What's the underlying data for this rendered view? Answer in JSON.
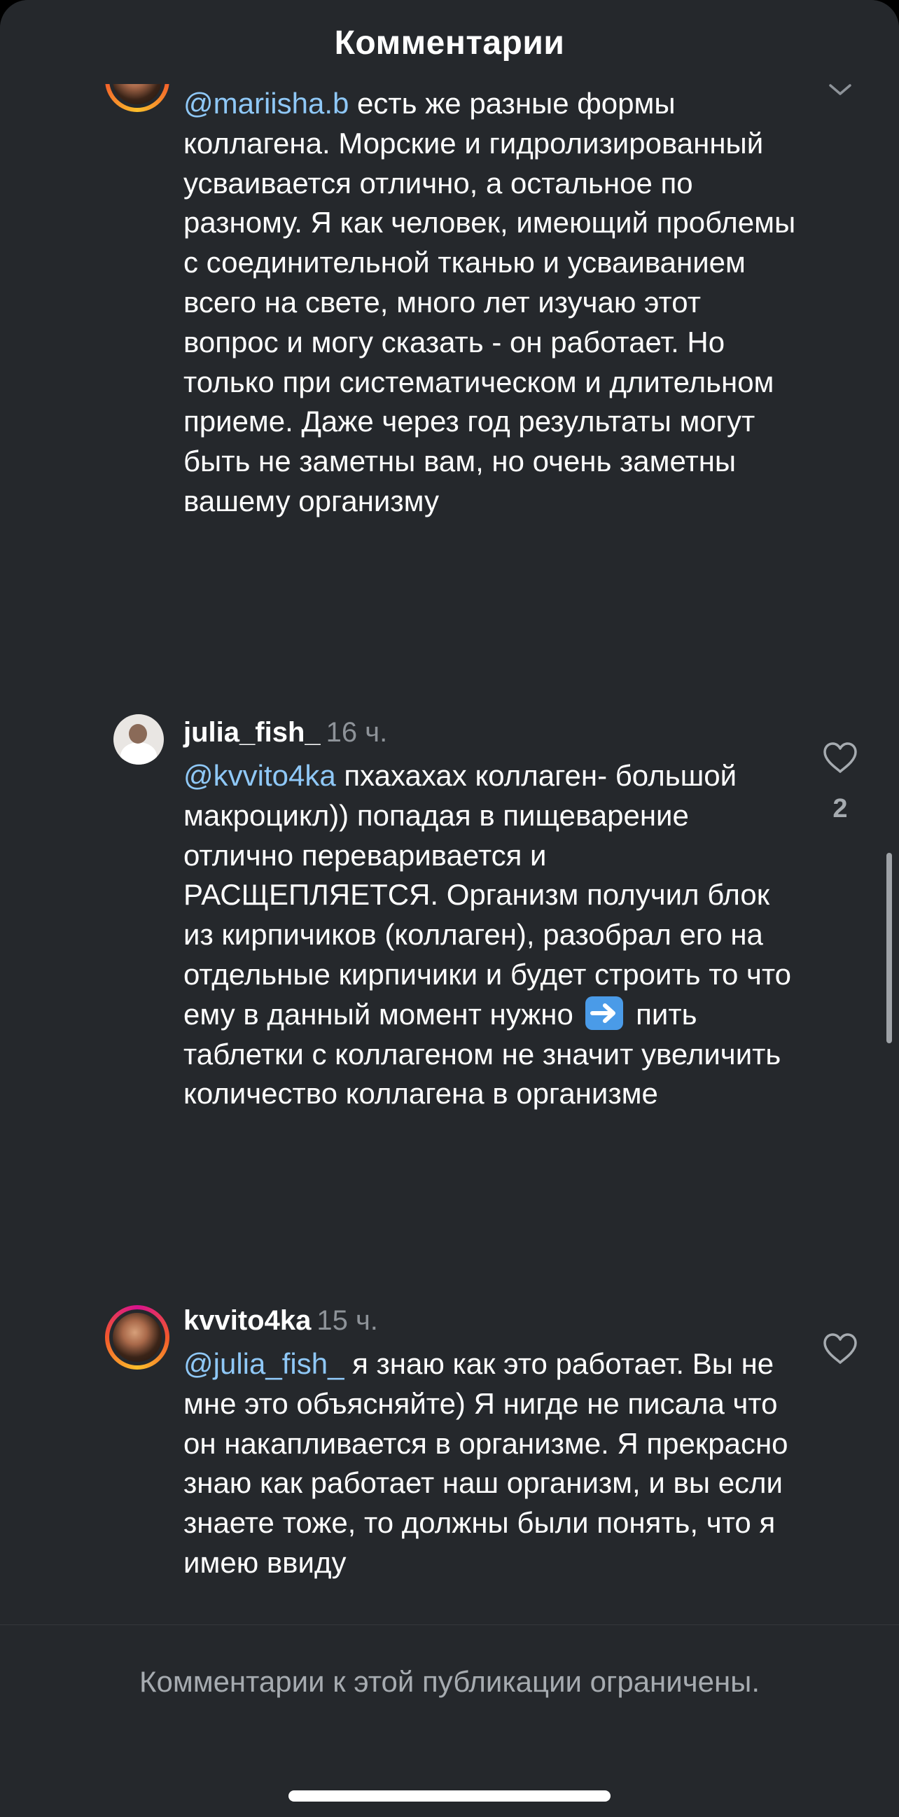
{
  "header": {
    "title": "Комментарии"
  },
  "comments": [
    {
      "username": "",
      "time": "",
      "mention": "@mariisha.b",
      "text": " есть же разные формы коллагена. Морские и гидролизированный усваивается отлично, а остальное по разному. Я как человек, имеющий проблемы с соединительной тканью и усваиванием всего на свете, много лет изучаю этот вопрос и могу сказать - он работает. Но только при систематическом и длительном приеме. Даже через год результаты могут быть не заметны вам, но очень заметны вашему организму",
      "likes": ""
    },
    {
      "username": "julia_fish_",
      "time": "16 ч.",
      "mention": "@kvvito4ka",
      "text_before_emoji": " пхахахах коллаген- большой макроцикл)) попадая в пищеварение отлично переваривается и РАСЩЕПЛЯЕТСЯ. Организм получил блок из кирпичиков (коллаген), разобрал его на отдельные кирпичики и будет строить то что ему в данный момент нужно",
      "emoji": "right-arrow-emoji",
      "text_after_emoji": " пить таблетки с коллагеном не значит увеличить количество коллагена в организме",
      "likes": "2"
    },
    {
      "username": "kvvito4ka",
      "time": "15 ч.",
      "mention": "@julia_fish_",
      "text": " я знаю как это работает. Вы не мне это объясняйте) Я нигде не писала что он накапливается в организме. Я прекрасно знаю как работает наш организм, и вы если знаете тоже, то должны были понять, что я имею ввиду",
      "likes": ""
    }
  ],
  "footer": {
    "notice": "Комментарии к этой публикации ограничены."
  },
  "icons": {
    "like": "heart-outline-icon",
    "collapse": "chevron-down-icon"
  },
  "colors": {
    "background": "#25282c",
    "mention": "#8fc8f7",
    "muted": "#8e9399"
  }
}
